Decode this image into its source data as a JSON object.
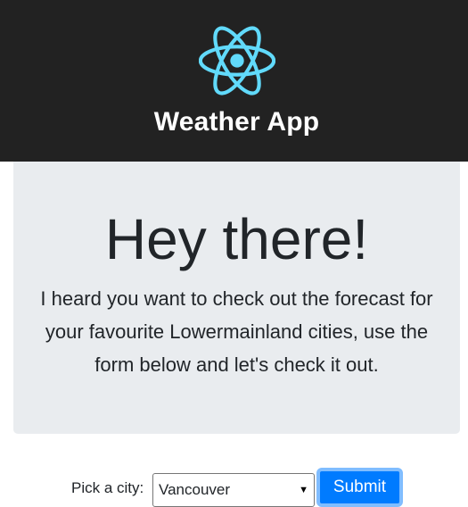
{
  "header": {
    "title": "Weather App",
    "logo_icon": "react-atom-icon",
    "logo_color": "#61dafb",
    "background": "#222222"
  },
  "jumbotron": {
    "heading": "Hey there!",
    "lead": "I heard you want to check out the forecast for your favourite Lowermainland cities, use the form below and let's check it out."
  },
  "form": {
    "label": "Pick a city:",
    "selected_city": "Vancouver",
    "submit_label": "Submit",
    "accent": "#007bff"
  }
}
